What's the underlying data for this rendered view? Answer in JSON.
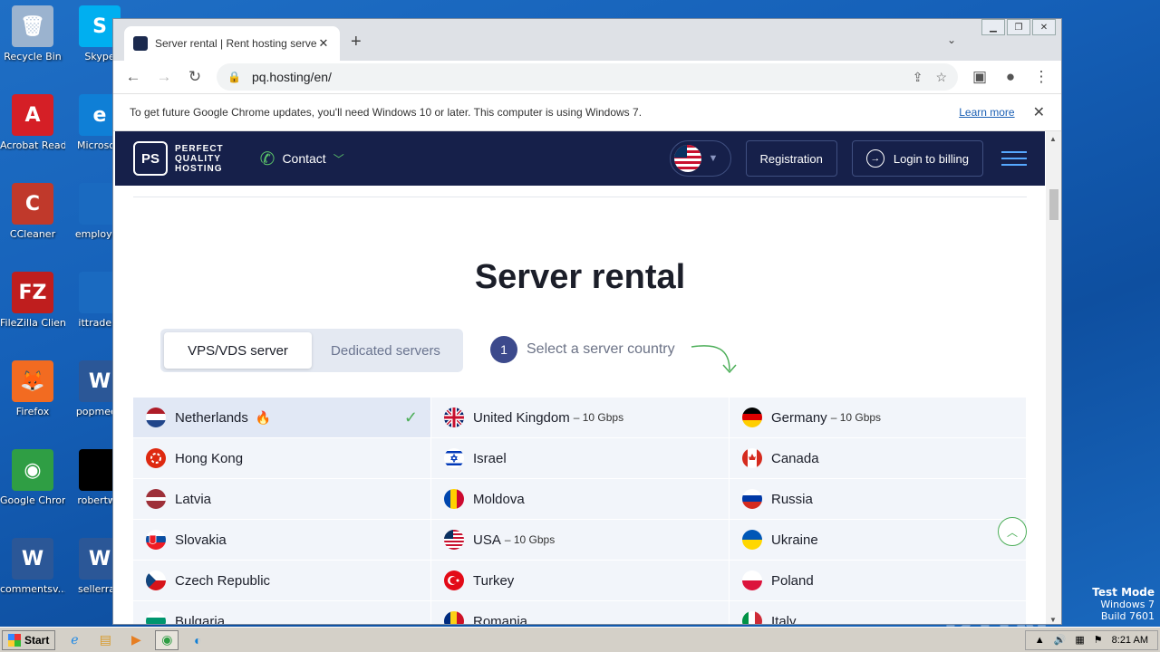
{
  "desktop": {
    "icons": [
      {
        "label": "Recycle Bin",
        "color": "#9bb3cf",
        "glyph": "🗑"
      },
      {
        "label": "Acrobat Reader DC",
        "color": "#d51f26",
        "glyph": "A"
      },
      {
        "label": "CCleaner",
        "color": "#c0392b",
        "glyph": "C"
      },
      {
        "label": "FileZilla Client",
        "color": "#bf1e1e",
        "glyph": "FZ"
      },
      {
        "label": "Firefox",
        "color": "#f26b21",
        "glyph": "🦊"
      },
      {
        "label": "Google Chrome",
        "color": "#2f9e44",
        "glyph": "◉"
      },
      {
        "label": "commentsv...",
        "color": "#2b5797",
        "glyph": "W"
      }
    ],
    "icons2": [
      {
        "label": "Skype",
        "color": "#00aff0",
        "glyph": "S"
      },
      {
        "label": "Microsoft",
        "color": "#0f7fd6",
        "glyph": "e"
      },
      {
        "label": "employee",
        "color": "#1a6ac0",
        "glyph": ""
      },
      {
        "label": "ittrade.p",
        "color": "#1a6ac0",
        "glyph": ""
      },
      {
        "label": "popmeeti",
        "color": "#2b5797",
        "glyph": "W"
      },
      {
        "label": "robertwe",
        "color": "#000000",
        "glyph": ""
      },
      {
        "label": "sellerrap",
        "color": "#2b5797",
        "glyph": "W"
      }
    ],
    "watermark": "ANY RUN",
    "testmode": {
      "line1": "Test Mode",
      "line2": "Windows 7",
      "line3": "Build 7601"
    }
  },
  "browser": {
    "tab_title": "Server rental | Rent hosting servers",
    "tab_close": "✕",
    "new_tab": "+",
    "url": "pq.hosting/en/",
    "infobar": {
      "message": "To get future Google Chrome updates, you'll need Windows 10 or later. This computer is using Windows 7.",
      "link": "Learn more"
    }
  },
  "site": {
    "logo_mark": "PS",
    "logo_line1": "PERFECT",
    "logo_line2": "QUALITY",
    "logo_line3": "HOSTING",
    "contact": "Contact",
    "registration": "Registration",
    "login": "Login to billing",
    "heading": "Server rental",
    "toggle": [
      "VPS/VDS server",
      "Dedicated servers"
    ],
    "step_number": "1",
    "step_text": "Select a server country",
    "countries": [
      {
        "name": "Netherlands",
        "speed": "",
        "flag": "nl",
        "selected": true,
        "hot": true
      },
      {
        "name": "United Kingdom",
        "speed": "– 10 Gbps",
        "flag": "gb"
      },
      {
        "name": "Germany",
        "speed": "– 10 Gbps",
        "flag": "de"
      },
      {
        "name": "Hong Kong",
        "speed": "",
        "flag": "hk"
      },
      {
        "name": "Israel",
        "speed": "",
        "flag": "il"
      },
      {
        "name": "Canada",
        "speed": "",
        "flag": "ca"
      },
      {
        "name": "Latvia",
        "speed": "",
        "flag": "lv"
      },
      {
        "name": "Moldova",
        "speed": "",
        "flag": "md"
      },
      {
        "name": "Russia",
        "speed": "",
        "flag": "ru"
      },
      {
        "name": "Slovakia",
        "speed": "",
        "flag": "sk"
      },
      {
        "name": "USA",
        "speed": "– 10 Gbps",
        "flag": "us"
      },
      {
        "name": "Ukraine",
        "speed": "",
        "flag": "ua"
      },
      {
        "name": "Czech Republic",
        "speed": "",
        "flag": "cz"
      },
      {
        "name": "Turkey",
        "speed": "",
        "flag": "tr"
      },
      {
        "name": "Poland",
        "speed": "",
        "flag": "pl"
      },
      {
        "name": "Bulgaria",
        "speed": "",
        "flag": "bg"
      },
      {
        "name": "Romania",
        "speed": "",
        "flag": "ro"
      },
      {
        "name": "Italy",
        "speed": "",
        "flag": "it"
      }
    ]
  },
  "taskbar": {
    "start": "Start",
    "time": "8:21 AM"
  },
  "colors": {
    "header_bg": "#16204a",
    "accent_green": "#4cae58",
    "step_circle": "#3c4a8c"
  }
}
